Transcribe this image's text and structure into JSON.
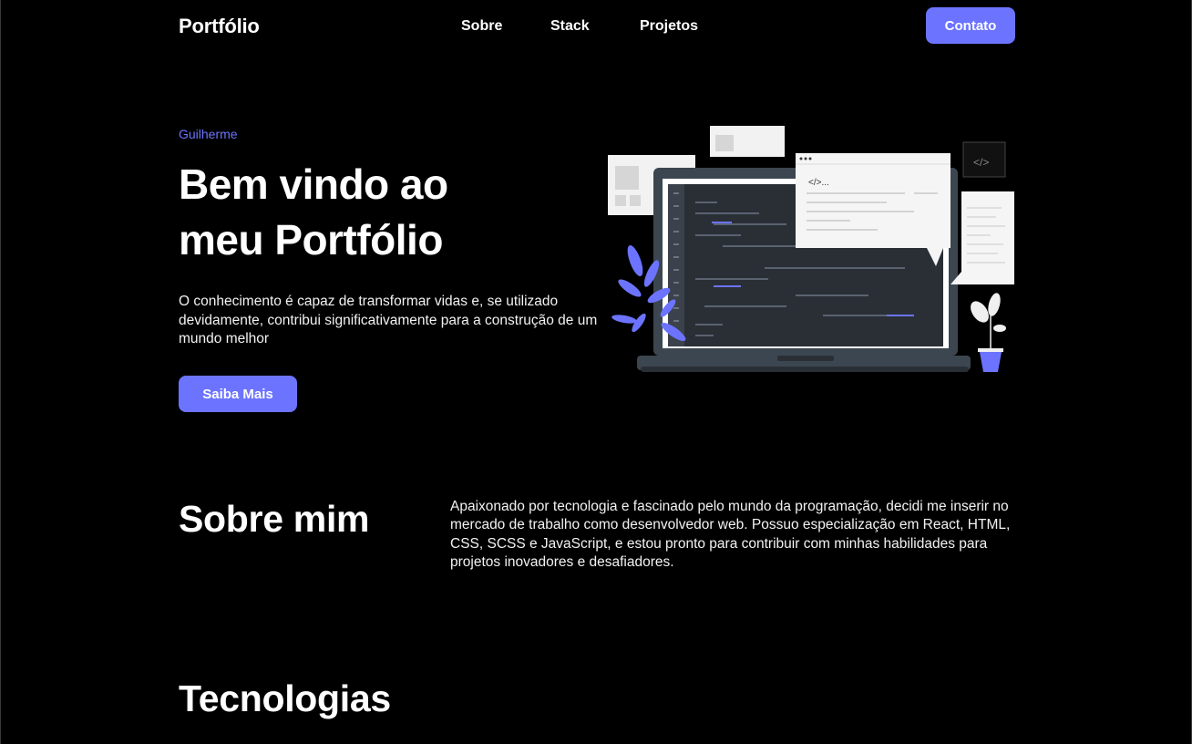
{
  "header": {
    "logo": "Portfólio",
    "nav": [
      "Sobre",
      "Stack",
      "Projetos"
    ],
    "contact_button": "Contato"
  },
  "hero": {
    "name": "Guilherme",
    "title_line1": "Bem vindo ao",
    "title_line2": "meu Portfólio",
    "text": "O conhecimento é capaz de transformar vidas e, se utilizado devidamente, contribui significativamente para a construção de um mundo melhor",
    "button": "Saiba Mais",
    "illustration_code_tag": "</>..."
  },
  "about": {
    "title": "Sobre mim",
    "text": "Apaixonado por tecnologia e fascinado pelo mundo da programação, decidi me inserir no mercado de trabalho como desenvolvedor web. Possuo especialização em React, HTML, CSS, SCSS e JavaScript, e estou pronto para contribuir com minhas habilidades para projetos inovadores e desafiadores."
  },
  "technologies": {
    "title": "Tecnologias"
  },
  "colors": {
    "background": "#000000",
    "accent": "#6c74ff",
    "text": "#ffffff"
  },
  "icons": [
    "code-window-icon",
    "plant-icon",
    "laptop-icon"
  ]
}
